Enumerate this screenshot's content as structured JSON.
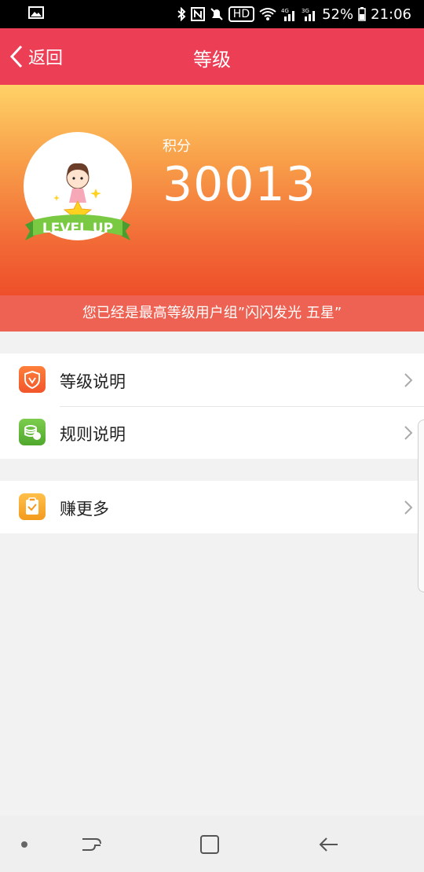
{
  "status_bar": {
    "battery": "52%",
    "time": "21:06",
    "hd": "HD",
    "icons": [
      "image-icon",
      "bluetooth-icon",
      "nfc-icon",
      "mute-icon",
      "wifi-icon",
      "signal-4g-icon",
      "signal-3g-icon",
      "battery-icon"
    ]
  },
  "header": {
    "back_label": "返回",
    "title": "等级"
  },
  "hero": {
    "points_label": "积分",
    "points_value": "30013",
    "badge_text": "LEVEL UP"
  },
  "notice": "您已经是最高等级用户组”闪闪发光 五星”",
  "menu": {
    "group1": [
      {
        "label": "等级说明",
        "icon": "shield-icon"
      },
      {
        "label": "规则说明",
        "icon": "coins-icon"
      }
    ],
    "group2": [
      {
        "label": "赚更多",
        "icon": "clipboard-check-icon"
      }
    ]
  },
  "colors": {
    "header": "#ec3f56",
    "hero_top": "#ffd266",
    "hero_bottom": "#ee4f2a",
    "notice": "#ee6253",
    "icon_orange": "#f26a2e",
    "icon_green": "#5cb83c",
    "icon_yellow": "#f5a623"
  }
}
